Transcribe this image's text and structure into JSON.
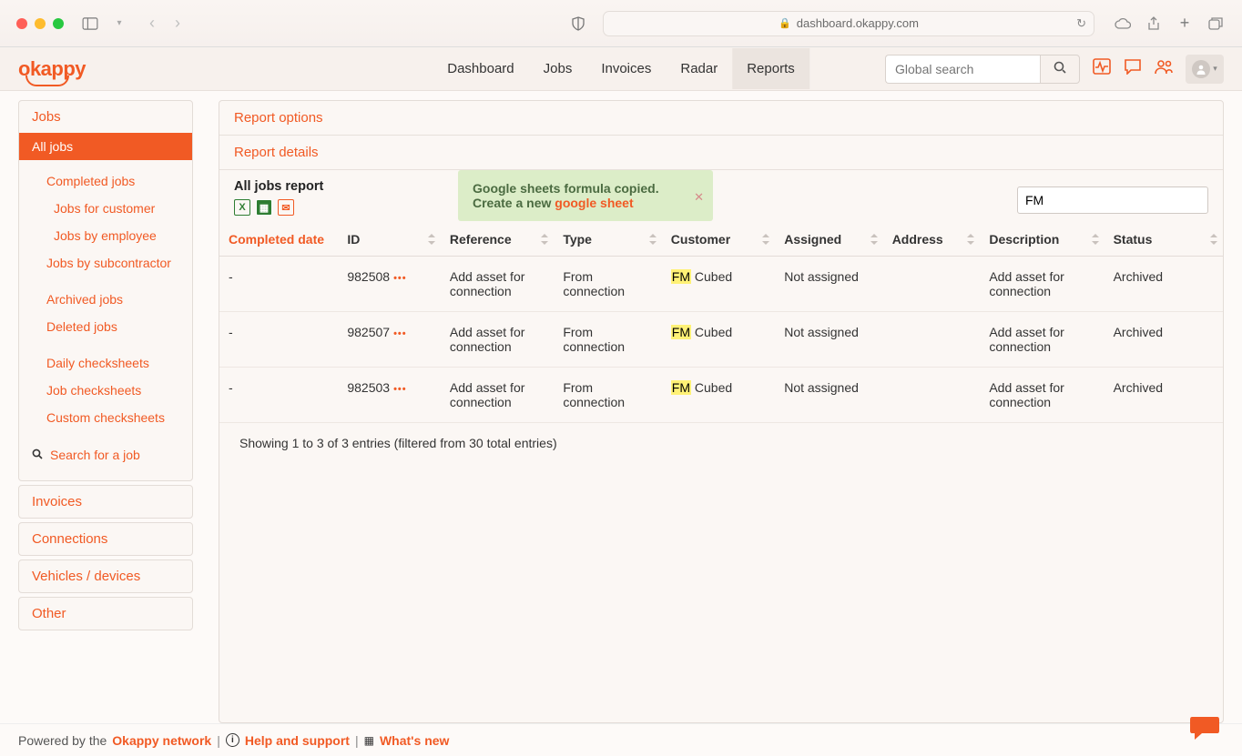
{
  "browser": {
    "url": "dashboard.okappy.com"
  },
  "logo": "okappy",
  "nav": {
    "dashboard": "Dashboard",
    "jobs": "Jobs",
    "invoices": "Invoices",
    "radar": "Radar",
    "reports": "Reports"
  },
  "globalSearch": {
    "placeholder": "Global search"
  },
  "sidebar": {
    "jobs": {
      "title": "Jobs",
      "all": "All jobs",
      "completed": "Completed jobs",
      "forCustomer": "Jobs for customer",
      "byEmployee": "Jobs by employee",
      "bySubcontractor": "Jobs by subcontractor",
      "archived": "Archived jobs",
      "deleted": "Deleted jobs",
      "daily": "Daily checksheets",
      "jobCheck": "Job checksheets",
      "custom": "Custom checksheets",
      "search": "Search for a job"
    },
    "invoices": "Invoices",
    "connections": "Connections",
    "vehicles": "Vehicles / devices",
    "other": "Other"
  },
  "main": {
    "reportOptions": "Report options",
    "reportDetails": "Report details",
    "reportTitle": "All jobs report",
    "filterValue": "FM",
    "toast": {
      "line1": "Google sheets formula copied.",
      "line2a": "Create a new ",
      "line2b": "google sheet"
    },
    "columns": {
      "completed": "Completed date",
      "id": "ID",
      "reference": "Reference",
      "type": "Type",
      "customer": "Customer",
      "assigned": "Assigned",
      "address": "Address",
      "description": "Description",
      "status": "Status"
    },
    "rows": [
      {
        "completed": "-",
        "id": "982508",
        "reference": "Add asset for connection",
        "type": "From connection",
        "customerHi": "FM",
        "customerRest": " Cubed",
        "assigned": "Not assigned",
        "address": "",
        "description": "Add asset for connection",
        "status": "Archived"
      },
      {
        "completed": "-",
        "id": "982507",
        "reference": "Add asset for connection",
        "type": "From connection",
        "customerHi": "FM",
        "customerRest": " Cubed",
        "assigned": "Not assigned",
        "address": "",
        "description": "Add asset for connection",
        "status": "Archived"
      },
      {
        "completed": "-",
        "id": "982503",
        "reference": "Add asset for connection",
        "type": "From connection",
        "customerHi": "FM",
        "customerRest": " Cubed",
        "assigned": "Not assigned",
        "address": "",
        "description": "Add asset for connection",
        "status": "Archived"
      }
    ],
    "entriesInfo": "Showing 1 to 3 of 3 entries (filtered from 30 total entries)"
  },
  "footer": {
    "poweredBy": "Powered by the ",
    "network": "Okappy network",
    "help": "Help and support",
    "whatsnew": "What's new"
  }
}
